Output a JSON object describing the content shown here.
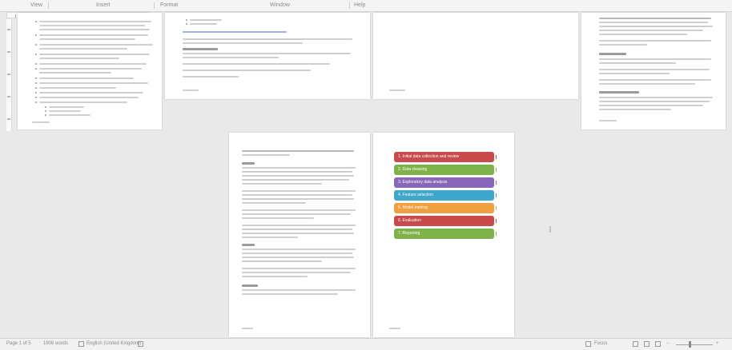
{
  "menu": {
    "view": "View",
    "insert": "Insert",
    "format": "Format",
    "window": "Window",
    "help": "Help"
  },
  "status": {
    "page_label": "Page 1 of 5",
    "word_count": "1906 words",
    "language": "English (United Kingdom)",
    "focus": "Focus",
    "zoom_icon": "zoom-slider-icon"
  },
  "colors": {
    "workspace": "#e9e9e9",
    "steps": [
      "#c94a4a",
      "#7fb34a",
      "#8a66b8",
      "#3fa7c9",
      "#f0a040",
      "#c94a4a",
      "#7fb34a"
    ]
  },
  "flow": {
    "steps": [
      "1. Initial data collection and review",
      "2. Data cleaning",
      "3. Exploratory data analysis",
      "4. Feature selection",
      "5. Model training",
      "6. Evaluation",
      "7. Reporting"
    ]
  }
}
